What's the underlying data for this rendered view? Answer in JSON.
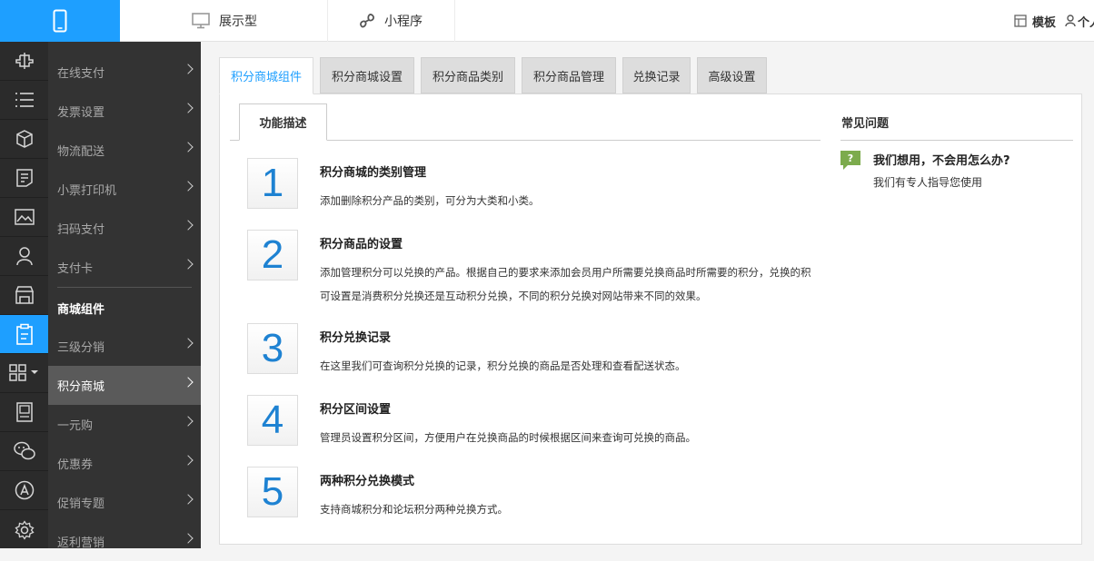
{
  "topbar": {
    "tabs": [
      {
        "label": "展示型",
        "icon": "monitor-icon"
      },
      {
        "label": "小程序",
        "icon": "mini-program-icon"
      }
    ],
    "right": {
      "template_label": "模板",
      "user_label": "个人"
    }
  },
  "iconbar": {
    "icons": [
      "plugin-icon",
      "list-icon",
      "cube-icon",
      "document-icon",
      "image-icon",
      "user-icon",
      "store-icon",
      "clipboard-icon",
      "grid-icon",
      "page-icon",
      "wechat-icon",
      "app-store-icon",
      "settings-icon"
    ],
    "active_index": 7
  },
  "menu": {
    "items": [
      {
        "label": "在线支付",
        "type": "item"
      },
      {
        "label": "发票设置",
        "type": "item"
      },
      {
        "label": "物流配送",
        "type": "item"
      },
      {
        "label": "小票打印机",
        "type": "item"
      },
      {
        "label": "扫码支付",
        "type": "item"
      },
      {
        "label": "支付卡",
        "type": "item"
      },
      {
        "label": "商城组件",
        "type": "section"
      },
      {
        "label": "三级分销",
        "type": "item"
      },
      {
        "label": "积分商城",
        "type": "item",
        "active": true
      },
      {
        "label": "一元购",
        "type": "item"
      },
      {
        "label": "优惠券",
        "type": "item"
      },
      {
        "label": "促销专题",
        "type": "item"
      },
      {
        "label": "返利营销",
        "type": "item"
      }
    ]
  },
  "tabs": [
    {
      "label": "积分商城组件",
      "active": true
    },
    {
      "label": "积分商城设置"
    },
    {
      "label": "积分商品类别"
    },
    {
      "label": "积分商品管理"
    },
    {
      "label": "兑换记录"
    },
    {
      "label": "高级设置"
    }
  ],
  "subtab": {
    "label": "功能描述"
  },
  "features": [
    {
      "num": "1",
      "title": "积分商城的类别管理",
      "desc": [
        "添加删除积分产品的类别，可分为大类和小类。"
      ]
    },
    {
      "num": "2",
      "title": "积分商品的设置",
      "desc": [
        "添加管理积分可以兑换的产品。根据自己的要求来添加会员用户所需要兑换商品时所需要的积分，兑换的积",
        "可设置是消费积分兑换还是互动积分兑换，不同的积分兑换对网站带来不同的效果。"
      ]
    },
    {
      "num": "3",
      "title": "积分兑换记录",
      "desc": [
        "在这里我们可查询积分兑换的记录，积分兑换的商品是否处理和查看配送状态。"
      ]
    },
    {
      "num": "4",
      "title": "积分区间设置",
      "desc": [
        "管理员设置积分区间，方便用户在兑换商品的时候根据区间来查询可兑换的商品。"
      ]
    },
    {
      "num": "5",
      "title": "两种积分兑换模式",
      "desc": [
        "支持商城积分和论坛积分两种兑换方式。"
      ]
    }
  ],
  "faq": {
    "title": "常见问题",
    "question": "我们想用，不会用怎么办?",
    "answer": "我们有专人指导您使用",
    "icon_text": "?"
  },
  "colors": {
    "accent": "#1e9fff",
    "number": "#1e82d2",
    "faq_icon": "#7cab4d"
  }
}
